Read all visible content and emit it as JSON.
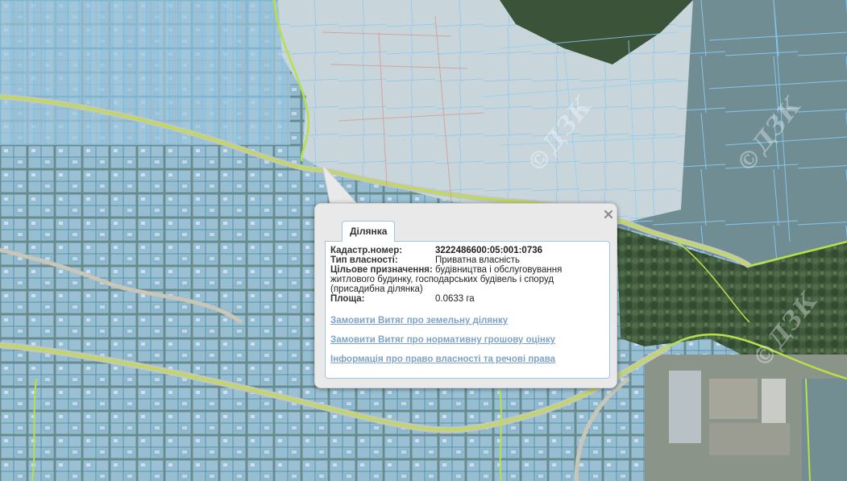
{
  "popup": {
    "tab_label": "Ділянка",
    "close_symbol": "×",
    "fields": {
      "cadastral_label": "Кадастр.номер:",
      "cadastral_value": "3222486600:05:001:0736",
      "ownership_label": "Тип власності:",
      "ownership_value": "Приватна власність",
      "purpose_label": "Цільове призначення:",
      "purpose_value_line1": "будівництва і обслуговування",
      "purpose_value_rest": "житлового будинку, господарських будівель і споруд (присадибна ділянка)",
      "area_label": "Площа:",
      "area_value": "0.0633 га"
    },
    "links": [
      "Замовити Витяг про земельну ділянку",
      "Замовити Витяг про нормативну грошову оцінку",
      "Інформація про право власності та речові права"
    ]
  },
  "map": {
    "watermark": "©ДЗК",
    "colors": {
      "parcel_fill": "#8ec8ef",
      "parcel_stroke": "#7cc2f2",
      "boundary_line": "#b7e04a",
      "field": "#c9d2cf",
      "forest": "#3f5a3c"
    }
  }
}
